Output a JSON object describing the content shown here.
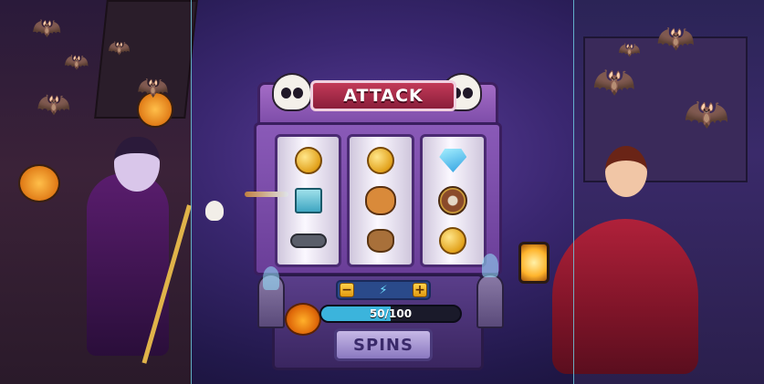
{
  "game": {
    "banner_title": "ATTACK",
    "spin_label": "SPINS",
    "energy": {
      "current": 50,
      "max": 100,
      "label": "50/100"
    },
    "bet": {
      "minus_label": "−",
      "plus_label": "+"
    }
  },
  "reels": [
    [
      "coin-stack-icon",
      "coin-box-icon",
      "cannon-icon"
    ],
    [
      "gold-coin-icon",
      "cat-hero-icon",
      "coin-sack-icon"
    ],
    [
      "diamond-gem-icon",
      "shield-icon",
      "coin-icon"
    ]
  ],
  "colors": {
    "energy_fill": "#3bb4dc",
    "banner": "#a52a4a",
    "machine_frame": "#7a4aa6",
    "spin_button": "#a898d4"
  }
}
